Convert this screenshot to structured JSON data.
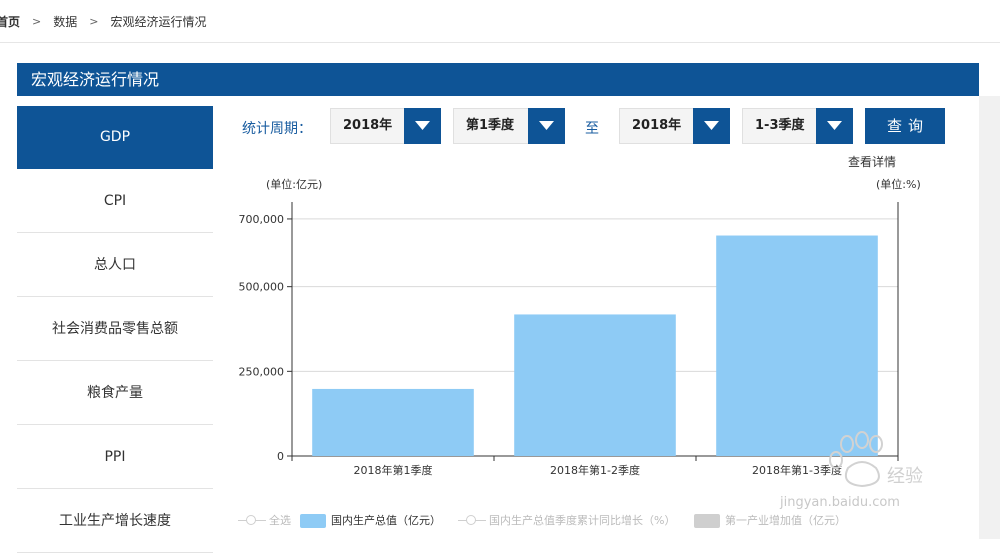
{
  "breadcrumb": {
    "home": "首页",
    "data": "数据",
    "current": "宏观经济运行情况",
    "separator": ">"
  },
  "page_title": "宏观经济运行情况",
  "sidebar": {
    "items": [
      {
        "label": "GDP",
        "active": true
      },
      {
        "label": "CPI",
        "active": false
      },
      {
        "label": "总人口",
        "active": false
      },
      {
        "label": "社会消费品零售总额",
        "active": false
      },
      {
        "label": "粮食产量",
        "active": false
      },
      {
        "label": "PPI",
        "active": false
      },
      {
        "label": "工业生产增长速度",
        "active": false
      }
    ]
  },
  "filter": {
    "label": "统计周期：",
    "start_year": "2018年",
    "start_quarter": "第1季度",
    "to_label": "至",
    "end_year": "2018年",
    "end_quarter": "1-3季度",
    "query_button": "查询",
    "detail_link": "查看详情"
  },
  "colors": {
    "brand": "#0e5496",
    "bar": "#8ecbf5"
  },
  "chart_data": {
    "type": "bar",
    "unit_left": "(单位:亿元)",
    "unit_right": "(单位:%)",
    "categories": [
      "2018年第1季度",
      "2018年第1-2季度",
      "2018年第1-3季度"
    ],
    "series": [
      {
        "name": "国内生产总值（亿元）",
        "values": [
          198000,
          418000,
          651000
        ]
      }
    ],
    "ylim": [
      0,
      750000
    ],
    "yticks": [
      0,
      250000,
      500000,
      700000
    ],
    "ytick_labels": [
      "0",
      "250,000",
      "500,000",
      "700,000"
    ],
    "grid": true,
    "legend": "bottom"
  },
  "legend": {
    "items": [
      {
        "label": "全选",
        "kind": "line",
        "active": false
      },
      {
        "label": "国内生产总值（亿元）",
        "kind": "rect",
        "active": true
      },
      {
        "label": "国内生产总值季度累计同比增长（%）",
        "kind": "line",
        "active": false
      },
      {
        "label": "第一产业增加值（亿元）",
        "kind": "rect",
        "active": false
      }
    ]
  },
  "watermark": {
    "text": "jingyan.baidu.com"
  }
}
